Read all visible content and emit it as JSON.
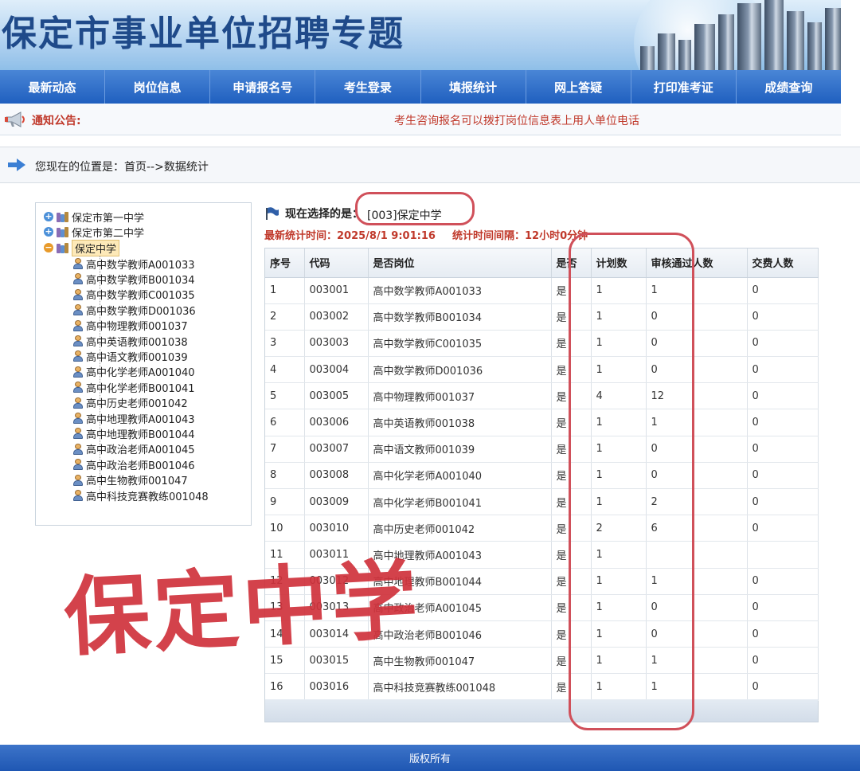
{
  "site": {
    "title": "保定市事业单位招聘专题"
  },
  "nav": [
    "最新动态",
    "岗位信息",
    "申请报名号",
    "考生登录",
    "填报统计",
    "网上答疑",
    "打印准考证",
    "成绩查询"
  ],
  "notice": {
    "label": "通知公告:",
    "text": "考生咨询报名可以拨打岗位信息表上用人单位电话"
  },
  "breadcrumb": "您现在的位置是：首页-->数据统计",
  "tree": {
    "roots": [
      "保定市第一中学",
      "保定市第二中学",
      "保定中学"
    ],
    "children": [
      "高中数学教师A001033",
      "高中数学教师B001034",
      "高中数学教师C001035",
      "高中数学教师D001036",
      "高中物理教师001037",
      "高中英语教师001038",
      "高中语文教师001039",
      "高中化学老师A001040",
      "高中化学老师B001041",
      "高中历史老师001042",
      "高中地理教师A001043",
      "高中地理教师B001044",
      "高中政治老师A001045",
      "高中政治老师B001046",
      "高中生物教师001047",
      "高中科技竞赛教练001048"
    ]
  },
  "selection": {
    "label": "现在选择的是：",
    "value": "[003]保定中学",
    "stat_time": "最新统计时间：2025/8/1 9:01:16",
    "interval": "统计时间间隔：12小时0分钟"
  },
  "table": {
    "headers": [
      "序号",
      "代码",
      "是否岗位",
      "是否",
      "计划数",
      "审核通过人数",
      "交费人数"
    ],
    "rows": [
      [
        "1",
        "003001",
        "高中数学教师A001033",
        "是",
        "1",
        "1",
        "0"
      ],
      [
        "2",
        "003002",
        "高中数学教师B001034",
        "是",
        "1",
        "0",
        "0"
      ],
      [
        "3",
        "003003",
        "高中数学教师C001035",
        "是",
        "1",
        "0",
        "0"
      ],
      [
        "4",
        "003004",
        "高中数学教师D001036",
        "是",
        "1",
        "0",
        "0"
      ],
      [
        "5",
        "003005",
        "高中物理教师001037",
        "是",
        "4",
        "12",
        "0"
      ],
      [
        "6",
        "003006",
        "高中英语教师001038",
        "是",
        "1",
        "1",
        "0"
      ],
      [
        "7",
        "003007",
        "高中语文教师001039",
        "是",
        "1",
        "0",
        "0"
      ],
      [
        "8",
        "003008",
        "高中化学老师A001040",
        "是",
        "1",
        "0",
        "0"
      ],
      [
        "9",
        "003009",
        "高中化学老师B001041",
        "是",
        "1",
        "2",
        "0"
      ],
      [
        "10",
        "003010",
        "高中历史老师001042",
        "是",
        "2",
        "6",
        "0"
      ],
      [
        "11",
        "003011",
        "高中地理教师A001043",
        "是",
        "1",
        "",
        ""
      ],
      [
        "12",
        "003012",
        "高中地理教师B001044",
        "是",
        "1",
        "1",
        "0"
      ],
      [
        "13",
        "003013",
        "高中政治老师A001045",
        "是",
        "1",
        "0",
        "0"
      ],
      [
        "14",
        "003014",
        "高中政治老师B001046",
        "是",
        "1",
        "0",
        "0"
      ],
      [
        "15",
        "003015",
        "高中生物教师001047",
        "是",
        "1",
        "1",
        "0"
      ],
      [
        "16",
        "003016",
        "高中科技竞赛教练001048",
        "是",
        "1",
        "1",
        "0"
      ]
    ]
  },
  "stamp": "保定中学",
  "footer": "版权所有",
  "colors": {
    "nav": "#1f5fbf",
    "alert_red": "#c0392b",
    "annotation": "#d0505a"
  }
}
